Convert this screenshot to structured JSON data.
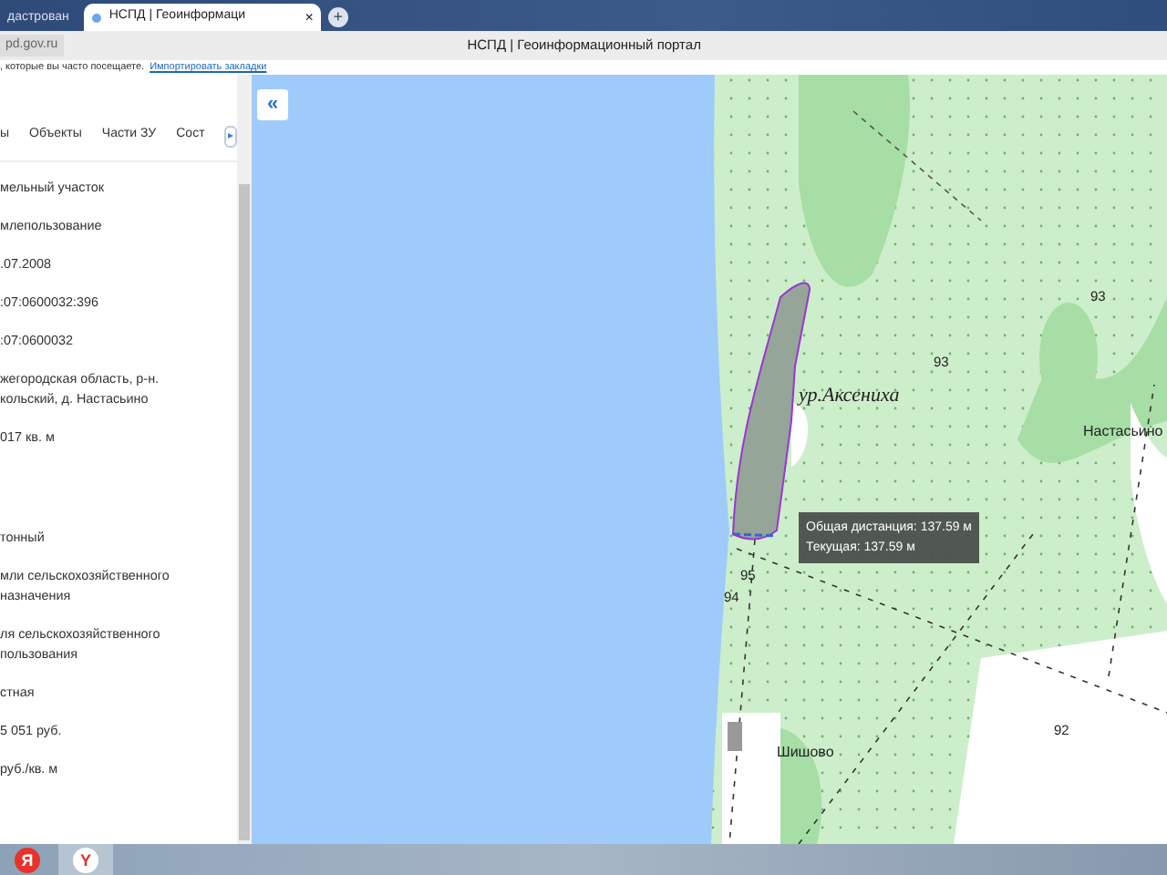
{
  "browser": {
    "tabs": [
      {
        "label": "дастрован",
        "selected": false
      },
      {
        "label": "НСПД | Геоинформаци",
        "selected": true
      }
    ],
    "tab_close": "×",
    "new_tab": "+",
    "address": "pd.gov.ru",
    "page_title": "НСПД | Геоинформационный портал",
    "bookmarks_bar": {
      "text": ", которые вы часто посещаете.",
      "link": "Импортировать закладки"
    }
  },
  "sidebar": {
    "tabs": [
      {
        "label": "ы"
      },
      {
        "label": "Объекты"
      },
      {
        "label": "Части ЗУ"
      },
      {
        "label": "Сост"
      }
    ],
    "tab_scroll_button": "▸",
    "sections": [
      [
        {
          "value": "мельный участок"
        },
        {
          "value": "млепользование"
        },
        {
          "value": ".07.2008"
        },
        {
          "value": ":07:0600032:396"
        },
        {
          "value": ":07:0600032"
        },
        {
          "value": "жегородская область, р-н. кольский, д. Настасьино"
        },
        {
          "value": "017 кв. м"
        }
      ],
      [
        {
          "value": "тонный"
        },
        {
          "value": "мли сельскохозяйственного назначения"
        },
        {
          "value": "ля сельскохозяйственного пользования"
        },
        {
          "value": "стная"
        },
        {
          "value": "5 051 руб."
        },
        {
          "value": "руб./кв. м"
        }
      ]
    ]
  },
  "map": {
    "collapse_button": "«",
    "labels": [
      {
        "text": "93",
        "kind": "number"
      },
      {
        "text": "93",
        "kind": "number"
      },
      {
        "text": "ур.Аксениха",
        "kind": "tract"
      },
      {
        "text": "Настасьино",
        "kind": "village"
      },
      {
        "text": "95",
        "kind": "number"
      },
      {
        "text": "94",
        "kind": "number"
      },
      {
        "text": "Шишово",
        "kind": "village"
      },
      {
        "text": "92",
        "kind": "number"
      }
    ],
    "tooltip": [
      "Общая дистанция: 137.59 м",
      "Текущая: 137.59 м"
    ]
  },
  "taskbar": {
    "apps": [
      {
        "label": "Я",
        "kind": "search"
      },
      {
        "label": "Y",
        "kind": "browser",
        "selected": true
      }
    ]
  }
}
